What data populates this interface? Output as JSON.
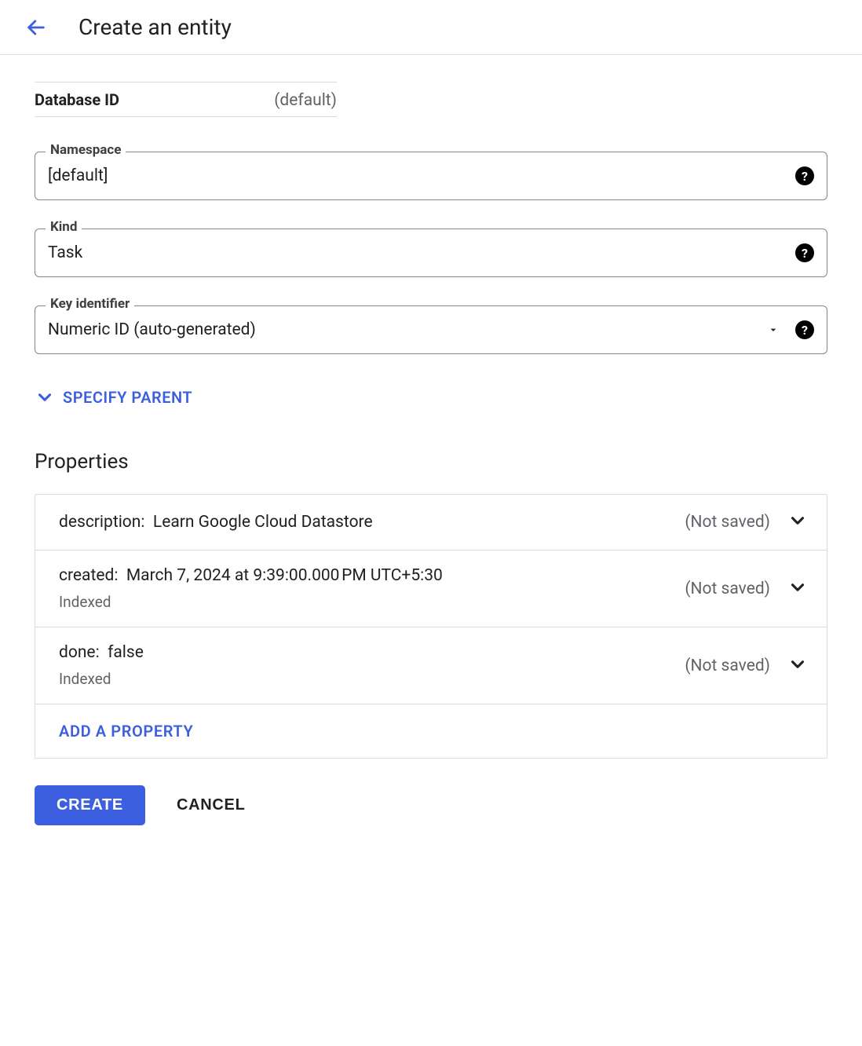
{
  "header": {
    "title": "Create an entity"
  },
  "database": {
    "label": "Database ID",
    "value": "(default)"
  },
  "fields": {
    "namespace": {
      "label": "Namespace",
      "value": "[default]"
    },
    "kind": {
      "label": "Kind",
      "value": "Task"
    },
    "key": {
      "label": "Key identifier",
      "value": "Numeric ID (auto-generated)"
    }
  },
  "specify_parent": "SPECIFY PARENT",
  "properties": {
    "title": "Properties",
    "status_label": "(Not saved)",
    "indexed_label": "Indexed",
    "items": [
      {
        "name": "description",
        "value": "Learn Google Cloud Datastore",
        "indexed": false
      },
      {
        "name": "created",
        "value": "March 7, 2024 at 9:39:00.000 PM UTC+5:30",
        "indexed": true
      },
      {
        "name": "done",
        "value": "false",
        "indexed": true
      }
    ],
    "add_label": "ADD A PROPERTY"
  },
  "actions": {
    "create": "CREATE",
    "cancel": "CANCEL"
  }
}
